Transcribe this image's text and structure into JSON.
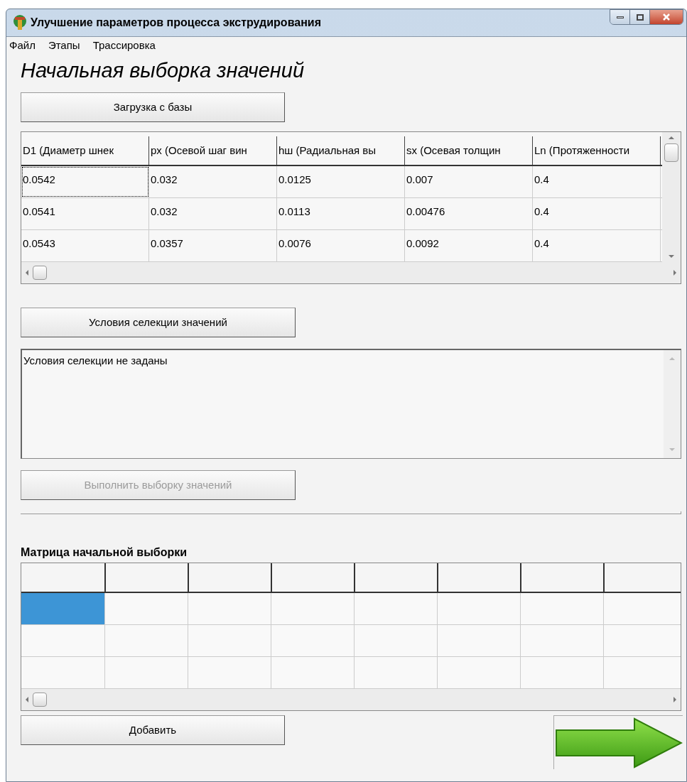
{
  "window": {
    "title": "Улучшение параметров процесса экструдирования"
  },
  "menu": [
    "Файл",
    "Этапы",
    "Трассировка"
  ],
  "heading": "Начальная выборка значений",
  "load_button": {
    "label": "Загрузка с базы",
    "disabled": false
  },
  "values_table": {
    "columns": [
      "D1 (Диаметр шнек",
      "px (Осевой шаг вин",
      "hш (Радиальная вы",
      "sx (Осевая толщин",
      "Ln (Протяженности"
    ],
    "rows": [
      [
        {
          "text": "0.0542",
          "focused": true
        },
        {
          "text": "0.032",
          "focused": false
        },
        {
          "text": "0.0125",
          "focused": false
        },
        {
          "text": "0.007",
          "focused": false
        },
        {
          "text": "0.4",
          "focused": false
        }
      ],
      [
        {
          "text": "0.0541",
          "focused": false
        },
        {
          "text": "0.032",
          "focused": false
        },
        {
          "text": "0.0113",
          "focused": false
        },
        {
          "text": "0.00476",
          "focused": false
        },
        {
          "text": "0.4",
          "focused": false
        }
      ],
      [
        {
          "text": "0.0543",
          "focused": false
        },
        {
          "text": "0.0357",
          "focused": false
        },
        {
          "text": "0.0076",
          "focused": false
        },
        {
          "text": "0.0092",
          "focused": false
        },
        {
          "text": "0.4",
          "focused": false
        }
      ]
    ]
  },
  "conditions_button": {
    "label": "Условия селекции значений",
    "disabled": false
  },
  "conditions_text": "Условия селекции не заданы",
  "run_button": {
    "label": "Выполнить выборку значений",
    "disabled": true
  },
  "matrix": {
    "title": "Матрица начальной выборки",
    "column_count_cells": [
      {},
      {},
      {},
      {},
      {},
      {},
      {},
      {}
    ],
    "rows": [
      [
        {
          "selected": true
        },
        {
          "selected": false
        },
        {
          "selected": false
        },
        {
          "selected": false
        },
        {
          "selected": false
        },
        {
          "selected": false
        },
        {
          "selected": false
        },
        {
          "selected": false
        }
      ],
      [
        {
          "selected": false
        },
        {
          "selected": false
        },
        {
          "selected": false
        },
        {
          "selected": false
        },
        {
          "selected": false
        },
        {
          "selected": false
        },
        {
          "selected": false
        },
        {
          "selected": false
        }
      ],
      [
        {
          "selected": false
        },
        {
          "selected": false
        },
        {
          "selected": false
        },
        {
          "selected": false
        },
        {
          "selected": false
        },
        {
          "selected": false
        },
        {
          "selected": false
        },
        {
          "selected": false
        }
      ]
    ]
  },
  "add_button": {
    "label": "Добавить",
    "disabled": false
  }
}
